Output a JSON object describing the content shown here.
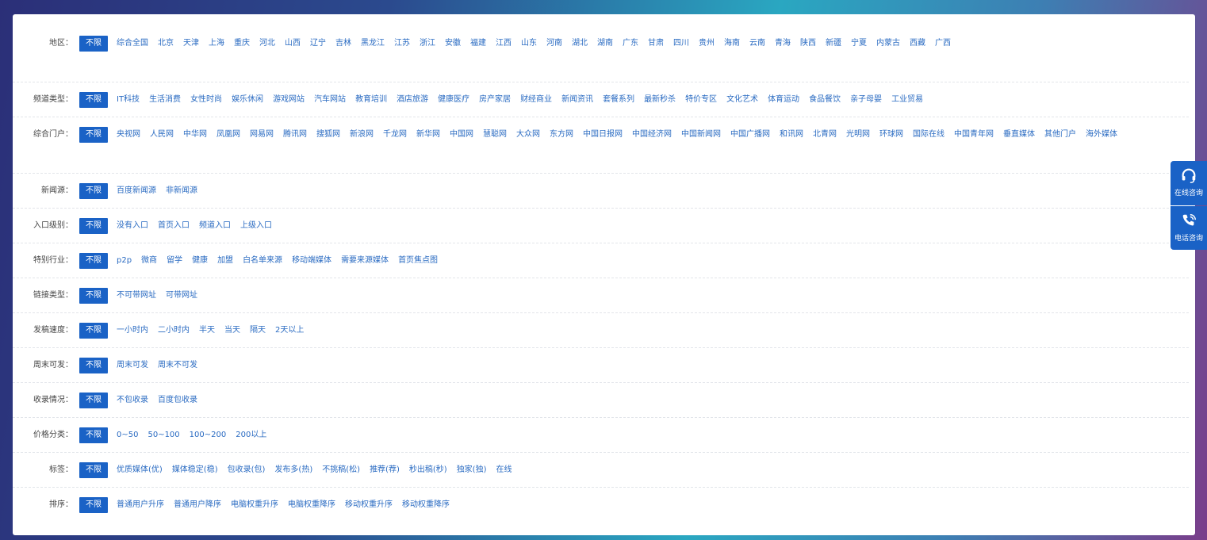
{
  "rows": [
    {
      "label": "地区：",
      "all": "不限",
      "options": [
        "综合全国",
        "北京",
        "天津",
        "上海",
        "重庆",
        "河北",
        "山西",
        "辽宁",
        "吉林",
        "黑龙江",
        "江苏",
        "浙江",
        "安徽",
        "福建",
        "江西",
        "山东",
        "河南",
        "湖北",
        "湖南",
        "广东",
        "甘肃",
        "四川",
        "贵州",
        "海南",
        "云南",
        "青海",
        "陕西",
        "新疆",
        "宁夏",
        "内蒙古",
        "西藏",
        "广西"
      ]
    },
    {
      "label": "频道类型：",
      "all": "不限",
      "options": [
        "IT科技",
        "生活消费",
        "女性时尚",
        "娱乐休闲",
        "游戏网站",
        "汽车网站",
        "教育培训",
        "酒店旅游",
        "健康医疗",
        "房产家居",
        "财经商业",
        "新闻资讯",
        "套餐系列",
        "最新秒杀",
        "特价专区",
        "文化艺术",
        "体育运动",
        "食品餐饮",
        "亲子母婴",
        "工业贸易"
      ]
    },
    {
      "label": "综合门户：",
      "all": "不限",
      "options": [
        "央视网",
        "人民网",
        "中华网",
        "凤凰网",
        "网易网",
        "腾讯网",
        "搜狐网",
        "新浪网",
        "千龙网",
        "新华网",
        "中国网",
        "慧聪网",
        "大众网",
        "东方网",
        "中国日报网",
        "中国经济网",
        "中国新闻网",
        "中国广播网",
        "和讯网",
        "北青网",
        "光明网",
        "环球网",
        "国际在线",
        "中国青年网",
        "垂直媒体",
        "其他门户",
        "海外媒体"
      ]
    },
    {
      "label": "新闻源：",
      "all": "不限",
      "options": [
        "百度新闻源",
        "非新闻源"
      ]
    },
    {
      "label": "入口级别：",
      "all": "不限",
      "options": [
        "没有入口",
        "首页入口",
        "频道入口",
        "上级入口"
      ]
    },
    {
      "label": "特别行业：",
      "all": "不限",
      "options": [
        "p2p",
        "微商",
        "留学",
        "健康",
        "加盟",
        "白名单来源",
        "移动端媒体",
        "需要来源媒体",
        "首页焦点图"
      ]
    },
    {
      "label": "链接类型：",
      "all": "不限",
      "options": [
        "不可带网址",
        "可带网址"
      ]
    },
    {
      "label": "发稿速度：",
      "all": "不限",
      "options": [
        "一小时内",
        "二小时内",
        "半天",
        "当天",
        "隔天",
        "2天以上"
      ]
    },
    {
      "label": "周末可发：",
      "all": "不限",
      "options": [
        "周末可发",
        "周末不可发"
      ]
    },
    {
      "label": "收录情况：",
      "all": "不限",
      "options": [
        "不包收录",
        "百度包收录"
      ]
    },
    {
      "label": "价格分类：",
      "all": "不限",
      "options": [
        "0~50",
        "50~100",
        "100~200",
        "200以上"
      ]
    },
    {
      "label": "标签：",
      "all": "不限",
      "options": [
        "优质媒体(优)",
        "媒体稳定(稳)",
        "包收录(包)",
        "发布多(热)",
        "不挑稿(松)",
        "推荐(荐)",
        "秒出稿(秒)",
        "独家(独)",
        "在线"
      ]
    },
    {
      "label": "排序：",
      "all": "不限",
      "options": [
        "普通用户升序",
        "普通用户降序",
        "电脑权重升序",
        "电脑权重降序",
        "移动权重升序",
        "移动权重降序"
      ]
    }
  ],
  "side": {
    "online": {
      "icon": "headset-icon",
      "label": "在线咨询"
    },
    "phone": {
      "icon": "phone-icon",
      "label": "电话咨询"
    }
  },
  "colors": {
    "accent": "#1a62c6",
    "link": "#2a6bc2"
  }
}
